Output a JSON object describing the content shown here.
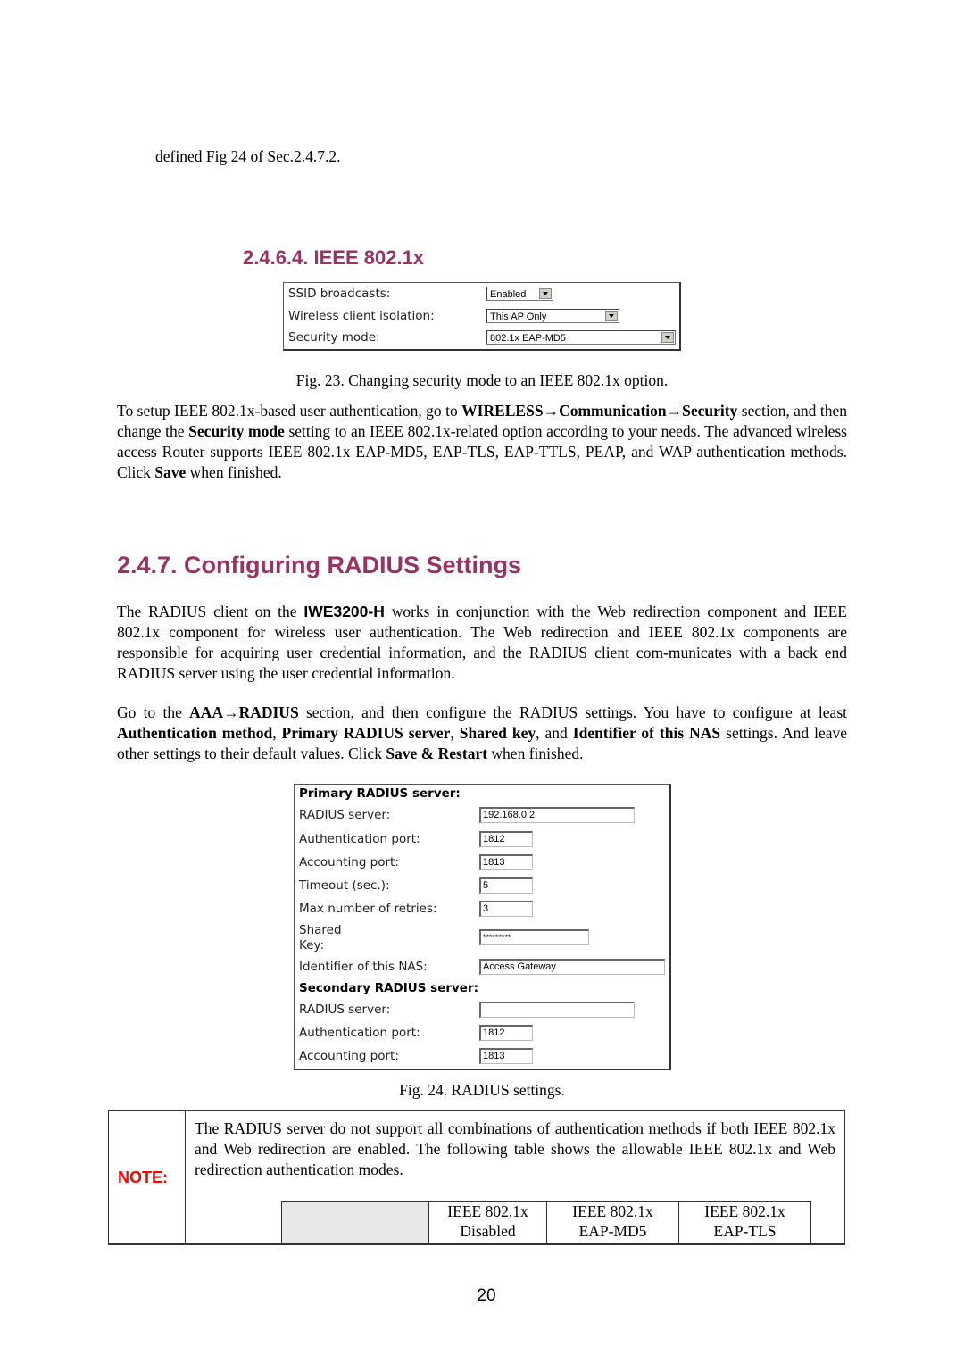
{
  "top_fragment": "defined Fig 24 of Sec.2.4.7.2.",
  "section_ieee": {
    "heading": "2.4.6.4. IEEE 802.1x",
    "form": {
      "rows": [
        {
          "label": "SSID broadcasts:",
          "value": "Enabled"
        },
        {
          "label": "Wireless client isolation:",
          "value": "This AP Only"
        },
        {
          "label": "Security mode:",
          "value": "802.1x EAP-MD5"
        }
      ]
    },
    "caption": "Fig. 23. Changing security mode to an IEEE 802.1x option.",
    "para": {
      "t1": "To setup IEEE 802.1x-based user authentication, go to ",
      "b1": "WIRELESS→Communication→Security",
      "t2": " section, and then change the ",
      "b2": "Security mode",
      "t3": " setting to an IEEE 802.1x-related option according to your needs. The advanced wireless access Router supports IEEE 802.1x EAP-MD5, EAP-TLS, EAP-TTLS, PEAP, and WAP authentication methods. Click ",
      "b3": "Save",
      "t4": " when finished."
    }
  },
  "section_radius": {
    "heading": "2.4.7. Configuring RADIUS Settings",
    "para1": {
      "t1": "The RADIUS client on the ",
      "b1": "IWE3200-H",
      "t2": " works in conjunction with the Web redirection component and IEEE 802.1x component for wireless user authentication. The Web redirection and IEEE 802.1x components are responsible for acquiring user credential information, and the RADIUS client com-municates with a back end RADIUS server using the user credential information."
    },
    "para2": {
      "t1": "Go to the ",
      "b1": "AAA→RADIUS",
      "t2": " section, and then configure the RADIUS settings. You have to configure at least ",
      "b2": "Authentication method",
      "t3": ", ",
      "b3": "Primary RADIUS server",
      "t4": ", ",
      "b4": "Shared key",
      "t5": ", and ",
      "b5": "Identifier of this NAS",
      "t6": " settings. And leave other settings to their default values. Click ",
      "b6": "Save & Restart",
      "t7": " when finished."
    },
    "form": {
      "primary_heading": "Primary RADIUS server:",
      "primary": {
        "server_label": "RADIUS server:",
        "server_value": "192.168.0.2",
        "auth_port_label": "Authentication port:",
        "auth_port_value": "1812",
        "acct_port_label": "Accounting port:",
        "acct_port_value": "1813",
        "timeout_label": "Timeout (sec.):",
        "timeout_value": "5",
        "retries_label": "Max number of retries:",
        "retries_value": "3",
        "shared_label_1": "Shared",
        "shared_label_2": "Key:",
        "shared_value": "*********",
        "nas_label": "Identifier of this NAS:",
        "nas_value": "Access Gateway"
      },
      "secondary_heading": "Secondary RADIUS server:",
      "secondary": {
        "server_label": "RADIUS server:",
        "server_value": "",
        "auth_port_label": "Authentication port:",
        "auth_port_value": "1812",
        "acct_port_label": "Accounting port:",
        "acct_port_value": "1813"
      }
    },
    "caption": "Fig. 24. RADIUS settings."
  },
  "note": {
    "label": "NOTE:",
    "text": "The RADIUS server do not support all combinations of authentication methods if both IEEE 802.1x and Web redirection are enabled. The following table shows the allowable IEEE 802.1x and Web redirection authentication modes.",
    "table_headers": [
      {
        "l1": "IEEE 802.1x",
        "l2": "Disabled"
      },
      {
        "l1": "IEEE 802.1x",
        "l2": "EAP-MD5"
      },
      {
        "l1": "IEEE 802.1x",
        "l2": "EAP-TLS"
      }
    ]
  },
  "page_number": "20"
}
